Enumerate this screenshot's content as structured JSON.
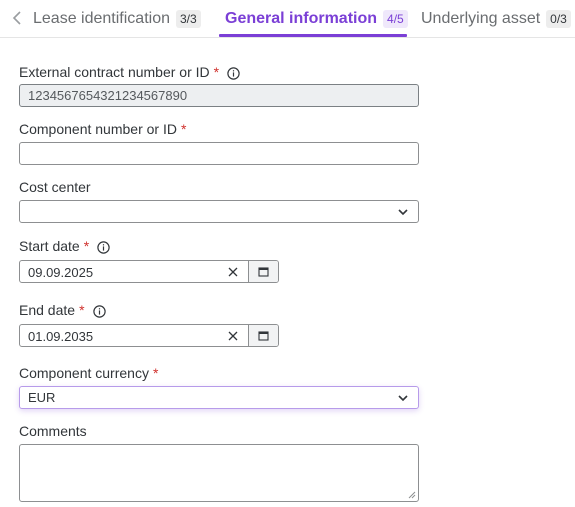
{
  "tabs": [
    {
      "label": "Lease identification",
      "count": "3/3",
      "active": false
    },
    {
      "label": "General information",
      "count": "4/5",
      "active": true
    },
    {
      "label": "Underlying asset",
      "count": "0/3",
      "active": false
    }
  ],
  "colors": {
    "accent": "#7b3fd6",
    "required": "#d0312d"
  },
  "form": {
    "external_contract": {
      "label": "External contract number or ID",
      "required": "*",
      "value": "1234567654321234567890"
    },
    "component_number": {
      "label": "Component number or ID",
      "required": "*",
      "value": ""
    },
    "cost_center": {
      "label": "Cost center",
      "value": ""
    },
    "start_date": {
      "label": "Start date",
      "required": "*",
      "value": "09.09.2025"
    },
    "end_date": {
      "label": "End date",
      "required": "*",
      "value": "01.09.2035"
    },
    "currency": {
      "label": "Component currency",
      "required": "*",
      "value": "EUR"
    },
    "comments": {
      "label": "Comments",
      "value": ""
    }
  }
}
